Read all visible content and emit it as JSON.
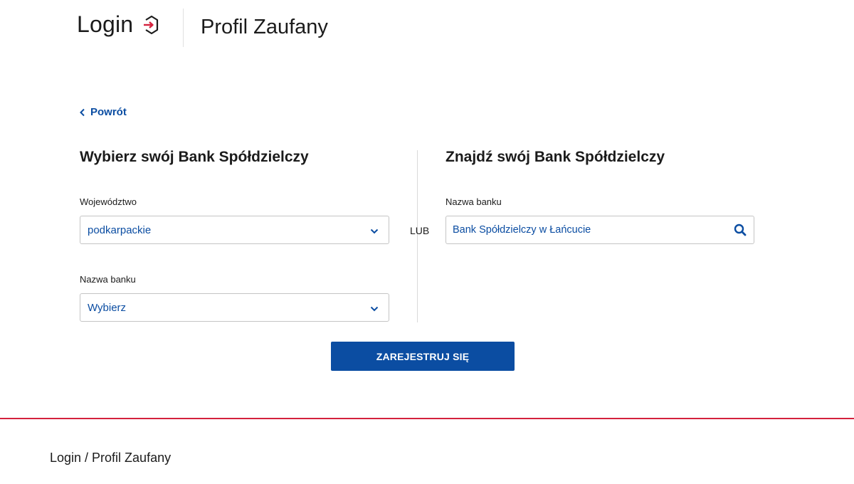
{
  "header": {
    "logo_text": "Login",
    "title": "Profil Zaufany",
    "logo_icon": "login-arrow-icon"
  },
  "back_link": {
    "label": "Powrót",
    "icon": "chevron-left-icon"
  },
  "left_panel": {
    "title": "Wybierz swój Bank Spółdzielczy",
    "voivodeship_label": "Województwo",
    "voivodeship_value": "podkarpackie",
    "bank_label": "Nazwa banku",
    "bank_value": "Wybierz"
  },
  "separator_label": "LUB",
  "right_panel": {
    "title": "Znajdź swój Bank Spółdzielczy",
    "search_label": "Nazwa banku",
    "search_value": "Bank Spółdzielczy w Łańcucie",
    "search_icon": "search-icon"
  },
  "submit_label": "ZAREJESTRUJ SIĘ",
  "footer": {
    "text": "Login / Profil Zaufany"
  },
  "colors": {
    "accent": "#0b4da2",
    "footer_line": "#d4213d"
  }
}
